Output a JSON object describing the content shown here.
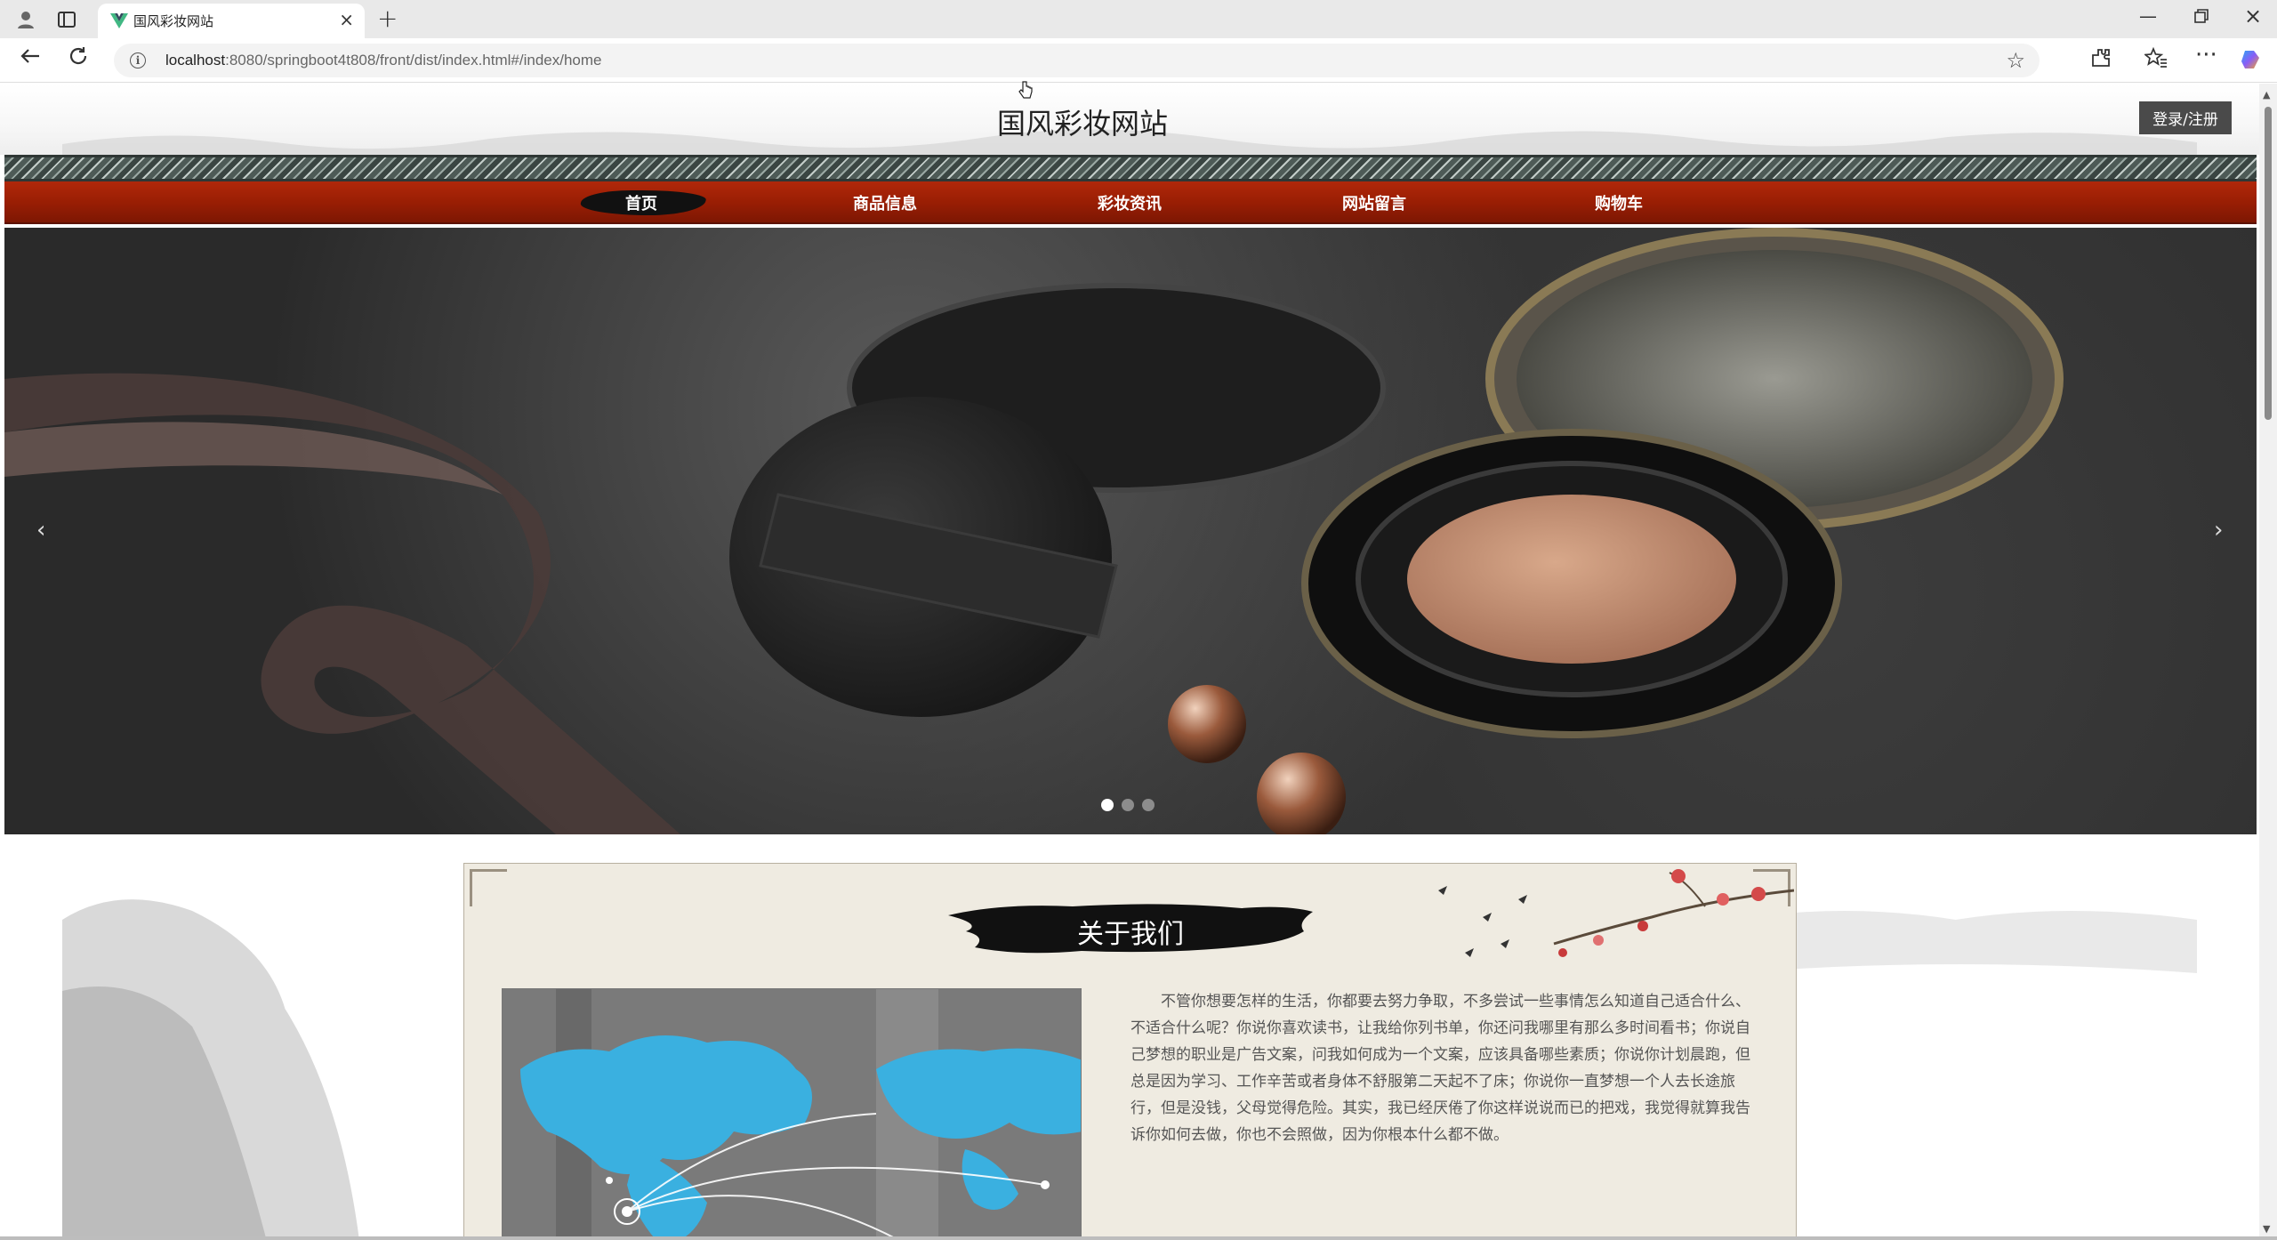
{
  "browser": {
    "tab_title": "国风彩妆网站",
    "url_host": "localhost",
    "url_rest": ":8080/springboot4t808/front/dist/index.html#/index/home",
    "icons": {
      "profile": "profile-icon",
      "tabs": "tab-strip-icon",
      "close": "close-icon",
      "new_tab": "plus-icon",
      "back": "back-arrow-icon",
      "reload": "reload-icon",
      "info": "info-icon",
      "star": "star-icon",
      "extensions": "extensions-icon",
      "favorites": "favorites-icon",
      "more": "more-icon",
      "copilot": "copilot-icon"
    }
  },
  "site": {
    "title": "国风彩妆网站",
    "login_label": "登录/注册",
    "nav": [
      {
        "label": "首页",
        "active": true
      },
      {
        "label": "商品信息",
        "active": false
      },
      {
        "label": "彩妆资讯",
        "active": false
      },
      {
        "label": "网站留言",
        "active": false
      },
      {
        "label": "购物车",
        "active": false
      }
    ],
    "banner": {
      "prev": "‹",
      "next": "›",
      "slide_count": 3,
      "active_slide": 1
    },
    "about": {
      "title": "关于我们",
      "text": "不管你想要怎样的生活，你都要去努力争取，不多尝试一些事情怎么知道自己适合什么、不适合什么呢？你说你喜欢读书，让我给你列书单，你还问我哪里有那么多时间看书；你说自己梦想的职业是广告文案，问我如何成为一个文案，应该具备哪些素质；你说你计划晨跑，但总是因为学习、工作辛苦或者身体不舒服第二天起不了床；你说你一直梦想一个人去长途旅行，但是没钱，父母觉得危险。其实，我已经厌倦了你这样说说而已的把戏，我觉得就算我告诉你如何去做，你也不会照做，因为你根本什么都不做。"
    }
  },
  "colors": {
    "nav_red": "#9a1e04",
    "login_bg": "#4a4a4a",
    "about_bg": "#efebe1",
    "map_blue": "#3ab0e0"
  }
}
